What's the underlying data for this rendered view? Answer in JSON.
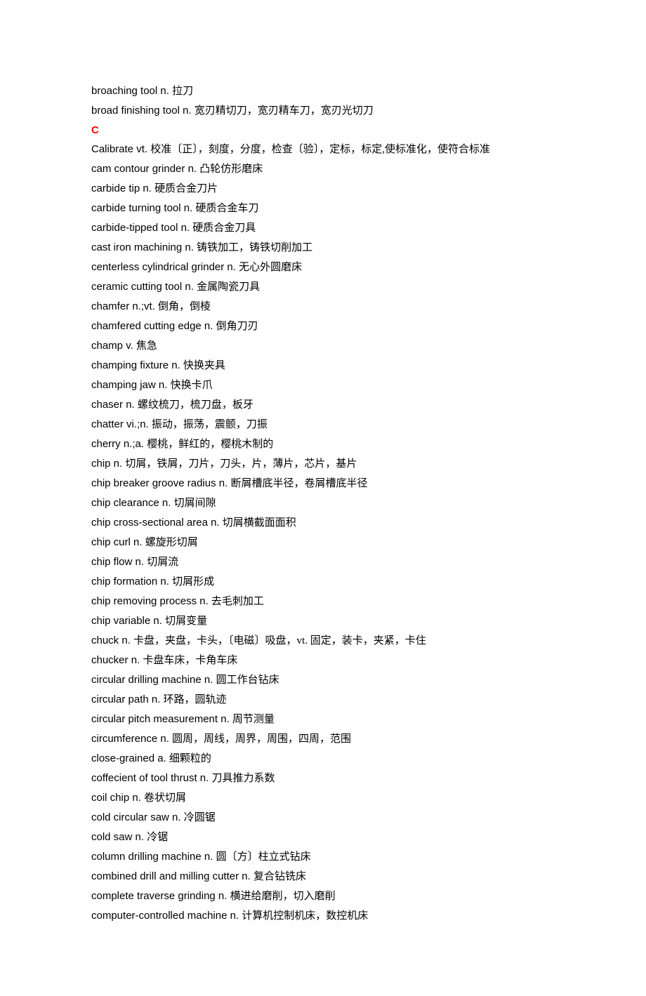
{
  "entries": [
    {
      "type": "entry",
      "term": "broaching tool n. ",
      "def": "拉刀"
    },
    {
      "type": "entry",
      "term": "broad finishing tool n. ",
      "def": "宽刃精切刀，宽刃精车刀，宽刃光切刀"
    },
    {
      "type": "section",
      "label": "C"
    },
    {
      "type": "entry",
      "term": "Calibrate vt. ",
      "def": "校准〔正〕，刻度，分度，检查〔验〕，定标，标定,使标准化，使符合标准"
    },
    {
      "type": "entry",
      "term": "cam contour grinder n. ",
      "def": "凸轮仿形磨床"
    },
    {
      "type": "entry",
      "term": "carbide tip n. ",
      "def": "硬质合金刀片"
    },
    {
      "type": "entry",
      "term": "carbide turning tool n. ",
      "def": "硬质合金车刀"
    },
    {
      "type": "entry",
      "term": "carbide-tipped tool n. ",
      "def": "硬质合金刀具"
    },
    {
      "type": "entry",
      "term": "cast iron machining n. ",
      "def": "铸铁加工，铸铁切削加工"
    },
    {
      "type": "entry",
      "term": "centerless cylindrical grinder n. ",
      "def": "无心外圆磨床"
    },
    {
      "type": "entry",
      "term": "ceramic cutting tool n. ",
      "def": "金属陶瓷刀具"
    },
    {
      "type": "entry",
      "term": "chamfer n.;vt. ",
      "def": "倒角，倒棱"
    },
    {
      "type": "entry",
      "term": "chamfered cutting edge n. ",
      "def": "倒角刀刃"
    },
    {
      "type": "entry",
      "term": "champ v. ",
      "def": "焦急"
    },
    {
      "type": "entry",
      "term": "champing fixture n. ",
      "def": "快换夹具"
    },
    {
      "type": "entry",
      "term": "champing jaw n. ",
      "def": "快换卡爪"
    },
    {
      "type": "entry",
      "term": "chaser n. ",
      "def": "螺纹梳刀，梳刀盘，板牙"
    },
    {
      "type": "entry",
      "term": "chatter vi.;n. ",
      "def": "振动，振荡，震颤，刀振"
    },
    {
      "type": "entry",
      "term": "cherry n.;a. ",
      "def": "樱桃，鲜红的，樱桃木制的"
    },
    {
      "type": "entry",
      "term": "chip n. ",
      "def": "切屑，铁屑，刀片，刀头，片，薄片，芯片，基片"
    },
    {
      "type": "entry",
      "term": "chip breaker groove radius n. ",
      "def": "断屑槽底半径，卷屑槽底半径"
    },
    {
      "type": "entry",
      "term": "chip clearance n. ",
      "def": "切屑间隙"
    },
    {
      "type": "entry",
      "term": "chip cross-sectional area n. ",
      "def": "切屑横截面面积"
    },
    {
      "type": "entry",
      "term": "chip curl n. ",
      "def": "螺旋形切屑"
    },
    {
      "type": "entry",
      "term": "chip flow n. ",
      "def": "切屑流"
    },
    {
      "type": "entry",
      "term": "chip formation n. ",
      "def": "切屑形成"
    },
    {
      "type": "entry",
      "term": "chip removing process n. ",
      "def": "去毛刺加工"
    },
    {
      "type": "entry",
      "term": "chip variable n. ",
      "def": "切屑变量"
    },
    {
      "type": "entry",
      "term": "chuck n. ",
      "def": "卡盘，夹盘，卡头，〔电磁〕吸盘，vt. 固定，装卡，夹紧，卡住"
    },
    {
      "type": "entry",
      "term": "chucker n. ",
      "def": "卡盘车床，卡角车床"
    },
    {
      "type": "entry",
      "term": "circular drilling machine n. ",
      "def": "圆工作台钻床"
    },
    {
      "type": "entry",
      "term": "circular path n. ",
      "def": "环路，圆轨迹"
    },
    {
      "type": "entry",
      "term": "circular pitch measurement n. ",
      "def": "周节测量"
    },
    {
      "type": "entry",
      "term": "circumference n. ",
      "def": "圆周，周线，周界，周围，四周，范围"
    },
    {
      "type": "entry",
      "term": "close-grained a. ",
      "def": "细颗粒的"
    },
    {
      "type": "entry",
      "term": "coffecient of tool thrust n. ",
      "def": "刀具推力系数"
    },
    {
      "type": "entry",
      "term": "coil chip n. ",
      "def": "卷状切屑"
    },
    {
      "type": "entry",
      "term": "cold circular saw n. ",
      "def": "冷圆锯"
    },
    {
      "type": "entry",
      "term": "cold saw n. ",
      "def": "冷锯"
    },
    {
      "type": "entry",
      "term": "column drilling machine n. ",
      "def": "圆〔方〕柱立式钻床"
    },
    {
      "type": "entry",
      "term": "combined drill and milling cutter n. ",
      "def": "复合钻铣床"
    },
    {
      "type": "entry",
      "term": "complete traverse grinding n. ",
      "def": "横进给磨削，切入磨削"
    },
    {
      "type": "entry",
      "term": "computer-controlled machine n. ",
      "def": "计算机控制机床，数控机床"
    }
  ]
}
